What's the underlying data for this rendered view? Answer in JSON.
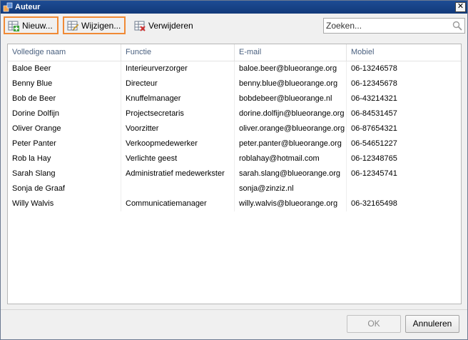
{
  "window": {
    "title": "Auteur",
    "close_glyph": "✕"
  },
  "toolbar": {
    "new_label": "Nieuw...",
    "edit_label": "Wijzigen...",
    "delete_label": "Verwijderen",
    "icons": {
      "new": "grid-add-icon",
      "edit": "grid-edit-icon",
      "delete": "grid-delete-icon"
    }
  },
  "search": {
    "placeholder": "Zoeken...",
    "value": ""
  },
  "table": {
    "columns": [
      "Volledige naam",
      "Functie",
      "E-mail",
      "Mobiel"
    ],
    "rows": [
      [
        "Baloe Beer",
        "Interieurverzorger",
        "baloe.beer@blueorange.org",
        "06-13246578"
      ],
      [
        "Benny Blue",
        "Directeur",
        "benny.blue@blueorange.org",
        "06-12345678"
      ],
      [
        "Bob de Beer",
        "Knuffelmanager",
        "bobdebeer@blueorange.nl",
        "06-43214321"
      ],
      [
        "Dorine Dolfijn",
        "Projectsecretaris",
        "dorine.dolfijn@blueorange.org",
        "06-84531457"
      ],
      [
        "Oliver Orange",
        "Voorzitter",
        "oliver.orange@blueorange.org",
        "06-87654321"
      ],
      [
        "Peter Panter",
        "Verkoopmedewerker",
        "peter.panter@blueorange.org",
        "06-54651227"
      ],
      [
        "Rob la Hay",
        "Verlichte geest",
        "roblahay@hotmail.com",
        "06-12348765"
      ],
      [
        "Sarah Slang",
        "Administratief medewerkster",
        "sarah.slang@blueorange.org",
        "06-12345741"
      ],
      [
        "Sonja de Graaf",
        "",
        "sonja@zinziz.nl",
        ""
      ],
      [
        "Willy Walvis",
        "Communicatiemanager",
        "willy.walvis@blueorange.org",
        "06-32165498"
      ]
    ]
  },
  "footer": {
    "ok_label": "OK",
    "cancel_label": "Annuleren"
  },
  "colors": {
    "titlebar": "#1d4c94",
    "highlight": "#f08a36",
    "header_text": "#4a607f"
  }
}
